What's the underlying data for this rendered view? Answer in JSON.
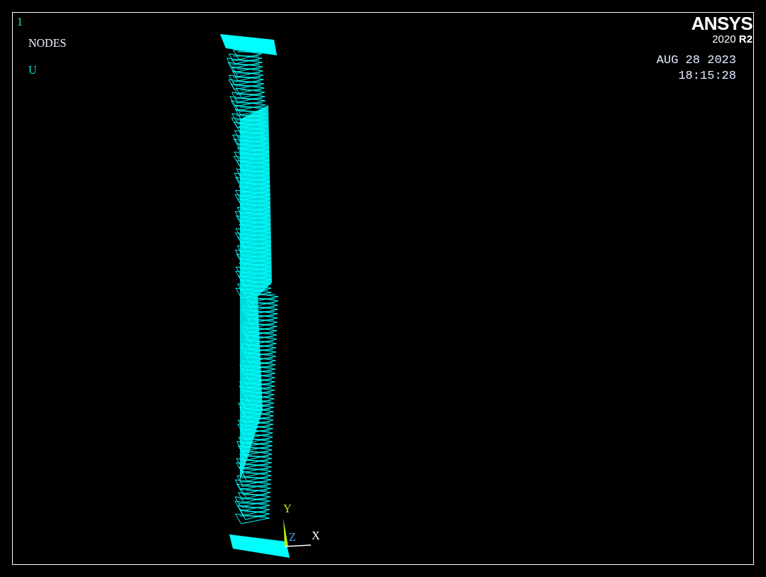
{
  "window_number": "1",
  "plot_title": "NODES",
  "result_label": "U",
  "logo": {
    "name": "ANSYS",
    "version": "2020 **R2**"
  },
  "date": "AUG 28 2023",
  "time": "18:15:28",
  "triad_axes": [
    "Y",
    "Z",
    "X"
  ]
}
